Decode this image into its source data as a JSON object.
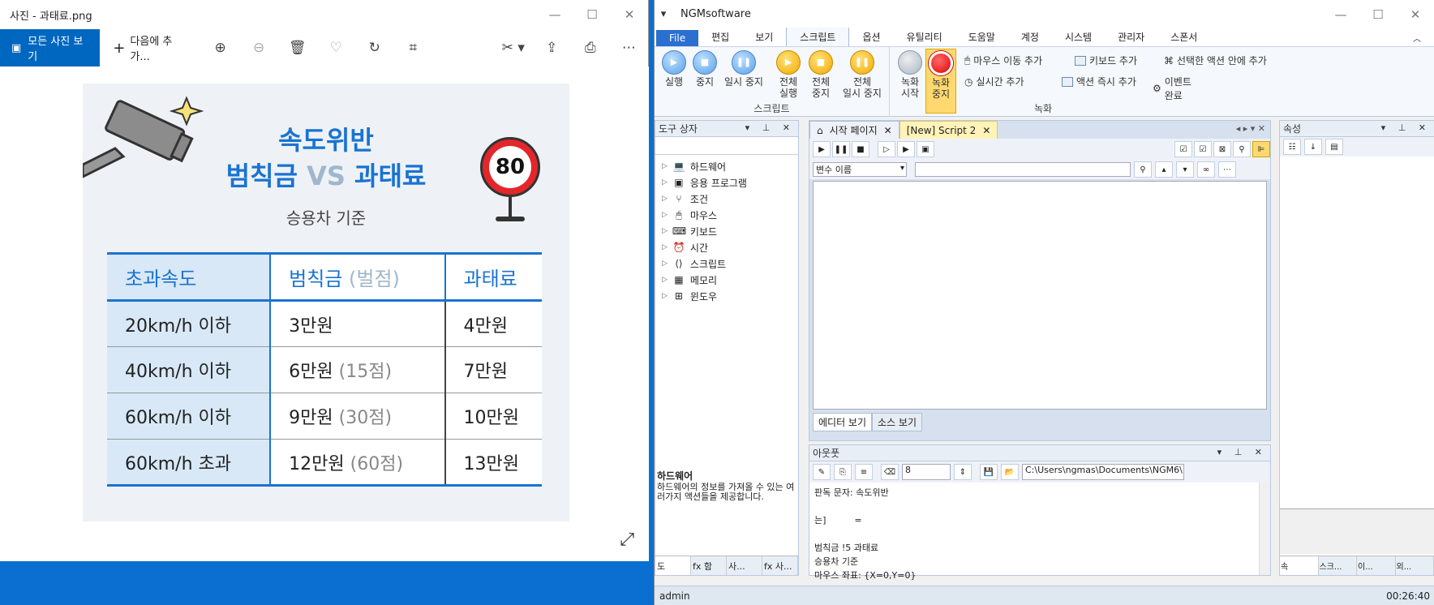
{
  "photos": {
    "title": "사진 - 과태료.png",
    "all_photos": "모든 사진 보기",
    "add_to": "다음에 추가...",
    "poster": {
      "title_line1": "속도위반",
      "title_line2a": "범칙금",
      "title_vs": "VS",
      "title_line2b": "과태료",
      "sign_number": "80",
      "subtitle": "승용차 기준",
      "headers": [
        "초과속도",
        "범칙금",
        "(벌점)",
        "과태료"
      ],
      "rows": [
        {
          "speed": "20km/h 이하",
          "fine": "3만원",
          "points": "",
          "penalty": "4만원"
        },
        {
          "speed": "40km/h 이하",
          "fine": "6만원",
          "points": "(15점)",
          "penalty": "7만원"
        },
        {
          "speed": "60km/h 이하",
          "fine": "9만원",
          "points": "(30점)",
          "penalty": "10만원"
        },
        {
          "speed": "60km/h 초과",
          "fine": "12만원",
          "points": "(60점)",
          "penalty": "13만원"
        }
      ]
    }
  },
  "ngm": {
    "title": "NGMsoftware",
    "menu": [
      "File",
      "편집",
      "보기",
      "스크립트",
      "옵션",
      "유틸리티",
      "도움말",
      "계정",
      "시스템",
      "관리자",
      "스폰서"
    ],
    "ribbon": {
      "run": "실행",
      "stop": "중지",
      "pause": "일시 중지",
      "all_run": [
        "전체",
        "실행"
      ],
      "all_stop": [
        "전체",
        "중지"
      ],
      "all_pause": [
        "전체",
        "일시 중지"
      ],
      "script_group": "스크립트",
      "rec_start": [
        "녹화",
        "시작"
      ],
      "rec_stop": [
        "녹화",
        "중지"
      ],
      "mouse_add": "마우스 이동 추가",
      "keyboard_add": "키보드 추가",
      "add_in_selected": "선택한 액션 안에 추가",
      "realtime_add": "실시간 추가",
      "action_add": "액션 즉시 추가",
      "event_done": "이벤트 완료",
      "record_group": "녹화"
    },
    "toolbox": {
      "title": "도구 상자",
      "items": [
        "하드웨어",
        "응용 프로그램",
        "조건",
        "마우스",
        "키보드",
        "시간",
        "스크립트",
        "메모리",
        "윈도우"
      ],
      "desc_title": "하드웨어",
      "desc_text": "하드웨어의 정보를 가져올 수 있는 여러가지 액션들을 제공합니다.",
      "tabs": [
        "도",
        "fx 함",
        "사...",
        "fx 사..."
      ]
    },
    "doc": {
      "tab_start": "시작 페이지",
      "tab_script": "[New] Script 2",
      "var_placeholder": "변수 이름",
      "tab_editor": "에디터 보기",
      "tab_source": "소스 보기"
    },
    "output": {
      "title": "아웃풋",
      "number": "8",
      "path": "C:\\Users\\ngmas\\Documents\\NGM6\\",
      "lines": [
        "판독 문자: 속도위반",
        "",
        "는]          =",
        "",
        "범칙금 !5 과태료",
        "승용차 기준",
        "마우스 좌표: {X=0,Y=0}"
      ]
    },
    "props": {
      "title": "속성",
      "tabs": [
        "속",
        "스크...",
        "이...",
        "외..."
      ]
    },
    "status": {
      "user": "admin",
      "time": "00:26:40"
    }
  }
}
